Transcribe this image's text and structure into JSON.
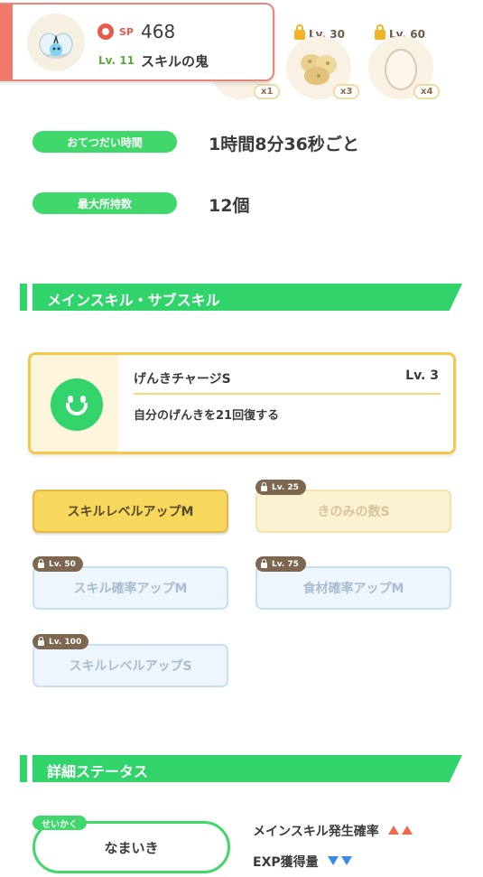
{
  "colors": {
    "accent_green": "#30d46a",
    "card_border_red": "#e9867a",
    "skill_gold": "#f4c94a",
    "stat_up": "#f06a4a",
    "stat_down": "#3a8ae8"
  },
  "pokemon": {
    "icon": "pokemon-portrait-icon",
    "sp_label": "SP",
    "sp_value": "468",
    "level_label": "Lv. 11",
    "name": "スキルの鬼"
  },
  "ingredients": [
    {
      "lock_label": "",
      "count": "x1",
      "icon": "ingredient-item-icon"
    },
    {
      "lock_label": "Lv. 30",
      "count": "x3",
      "icon": "potato-icon"
    },
    {
      "lock_label": "Lv. 60",
      "count": "x4",
      "icon": "egg-icon"
    }
  ],
  "info": {
    "help_time_label": "おてつだい時間",
    "help_time_value": "1時間8分36秒ごと",
    "max_carry_label": "最大所持数",
    "max_carry_value": "12個"
  },
  "skills_section": {
    "title": "メインスキル・サブスキル",
    "main_skill": {
      "icon": "smile-face-icon",
      "name": "げんきチャージS",
      "level": "Lv. 3",
      "description": "自分のげんきを21回復する"
    },
    "sub_skills": [
      {
        "label": "スキルレベルアップM",
        "lock": "",
        "style": "gold"
      },
      {
        "label": "きのみの数S",
        "lock": "Lv. 25",
        "style": "gold-locked"
      },
      {
        "label": "スキル確率アップM",
        "lock": "Lv. 50",
        "style": "blue-locked"
      },
      {
        "label": "食材確率アップM",
        "lock": "Lv. 75",
        "style": "blue-locked"
      },
      {
        "label": "スキルレベルアップS",
        "lock": "Lv. 100",
        "style": "blue-locked"
      }
    ]
  },
  "status_section": {
    "title": "詳細ステータス",
    "nature_tag": "せいかく",
    "nature_value": "なまいき",
    "effects": [
      {
        "label": "メインスキル発生確率",
        "direction": "up"
      },
      {
        "label": "EXP獲得量",
        "direction": "down"
      }
    ]
  }
}
